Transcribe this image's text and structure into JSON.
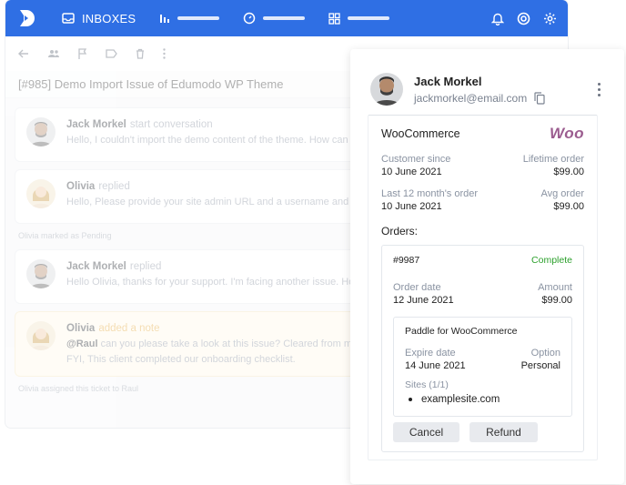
{
  "topbar": {
    "inbox_label": "INBOXES",
    "accent": "#2f6fe4"
  },
  "ticket": {
    "title": "[#985] Demo Import Issue of Edumodo WP Theme"
  },
  "thread": {
    "messages": [
      {
        "author": "Jack Morkel",
        "action": "start conversation",
        "text": "Hello, I couldn't import the demo content of the theme. How can I im"
      },
      {
        "author": "Olivia",
        "action": "replied",
        "text": "Hello, Please provide your site admin URL and a username and passw"
      },
      {
        "author": "Jack Morkel",
        "action": "replied",
        "text": "Hello Olivia, thanks for your support. I'm facing another issue. How ca"
      },
      {
        "author": "Olivia",
        "action": "added a note",
        "mention": "@Raul",
        "text": " can you please take a look at this issue? Cleared from my end",
        "text2": "FYI, This client completed our onboarding checklist."
      }
    ],
    "system": [
      "Olivia marked as Pending",
      "Olivia assigned this ticket to Raul"
    ]
  },
  "customer": {
    "name": "Jack Morkel",
    "email": "jackmorkel@email.com"
  },
  "woocommerce": {
    "title": "WooCommerce",
    "logo_text": "Woo",
    "brand_color": "#9b5c8f",
    "customer_since_label": "Customer since",
    "customer_since": "10 June 2021",
    "lifetime_order_label": "Lifetime order",
    "lifetime_order": "$99.00",
    "last12_label": "Last 12 month's order",
    "last12": "10 June 2021",
    "avg_order_label": "Avg order",
    "avg_order": "$99.00",
    "orders_label": "Orders:",
    "order": {
      "id": "#9987",
      "status": "Complete",
      "status_color": "#2ca02c",
      "date_label": "Order date",
      "date": "12 June 2021",
      "amount_label": "Amount",
      "amount": "$99.00",
      "subscription": {
        "title": "Paddle for WooCommerce",
        "expire_label": "Expire date",
        "expire": "14 June 2021",
        "option_label": "Option",
        "option": "Personal",
        "sites_label": "Sites (1/1)",
        "site": "examplesite.com"
      },
      "cancel_label": "Cancel",
      "refund_label": "Refund"
    }
  }
}
